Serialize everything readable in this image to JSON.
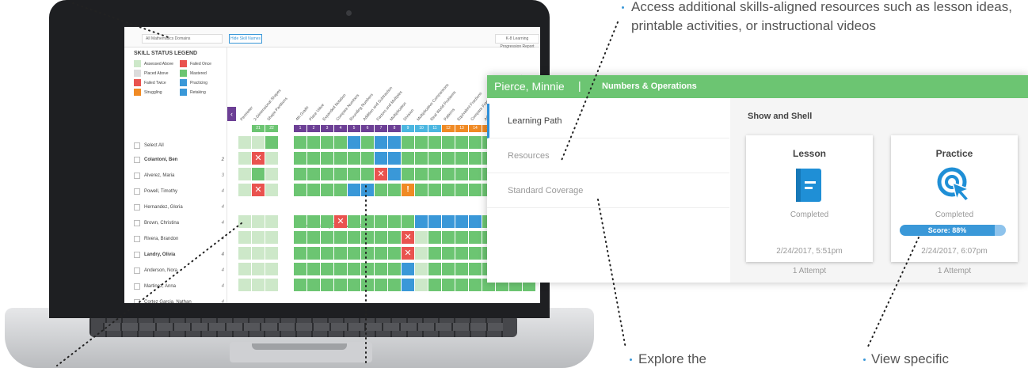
{
  "screen": {
    "domain_select": "All Mathematics Domains",
    "hide_button": "Hide Skill Names",
    "report_button": "K-8 Learning Progression Report",
    "legend_title": "SKILL STATUS LEGEND",
    "legend": [
      {
        "label": "Assessed Above",
        "color": "#cde8c9"
      },
      {
        "label": "Failed Once",
        "color": "#e9534f"
      },
      {
        "label": "Placed Above",
        "color": "#dcdcdc"
      },
      {
        "label": "Mastered",
        "color": "#6cc572"
      },
      {
        "label": "Failed Twice",
        "color": "#e9534f"
      },
      {
        "label": "Practicing",
        "color": "#3a98d8"
      },
      {
        "label": "Struggling",
        "color": "#f08a24"
      },
      {
        "label": "Retaking",
        "color": "#3a98d8"
      }
    ],
    "select_all": "Select All",
    "students": [
      {
        "name": "Colantoni, Ben",
        "count": "2"
      },
      {
        "name": "Alverez, Maria",
        "count": "3"
      },
      {
        "name": "Powell, Timothy",
        "count": "4"
      },
      {
        "name": "Hernandez, Gloria",
        "count": "4"
      },
      {
        "name": "Brown, Christina",
        "count": "4"
      },
      {
        "name": "Rivera, Brandon",
        "count": "4"
      },
      {
        "name": "Landry, Olivia",
        "count": "4"
      },
      {
        "name": "Anderson, Nora",
        "count": "4"
      },
      {
        "name": "Martinez, Anna",
        "count": "4"
      },
      {
        "name": "Cortez Garcia, Nathan",
        "count": "4"
      }
    ],
    "skills": [
      "Perimeter",
      "2-Dimensional Shapes",
      "Shape Partitions",
      "4th Grade",
      "Place Value",
      "Expanded Notation",
      "Compare Numbers",
      "Rounding Numbers",
      "Addition and Subtraction",
      "Factors and Multiples",
      "Multiplication",
      "Division",
      "Multiplicative Comparisons",
      "Real World Problems",
      "Patterns",
      "Equivalent Fractions",
      "Compare Fractions",
      "Adding and Subtracting Fractions"
    ],
    "skill_numbers": [
      "21",
      "22",
      "1",
      "2",
      "3",
      "4",
      "5",
      "6",
      "7",
      "8",
      "9",
      "10",
      "11",
      "12",
      "13",
      "14",
      "15"
    ],
    "no_path": "No Learning Path Available"
  },
  "panel": {
    "student": "Pierce, Minnie",
    "separator": "|",
    "unit": "Numbers & Operations",
    "nav": [
      "Learning Path",
      "Resources",
      "Standard Coverage"
    ],
    "section": "Show and Shell",
    "lesson": {
      "title": "Lesson",
      "status": "Completed",
      "date": "2/24/2017, 5:51pm",
      "attempts": "1 Attempt"
    },
    "practice": {
      "title": "Practice",
      "status": "Completed",
      "score": "Score: 88%",
      "score_fraction": 0.88,
      "date": "2/24/2017, 6:07pm",
      "attempts": "1 Attempt"
    }
  },
  "annotations": {
    "resources_note": "Access additional skills-aligned resources such as lesson ideas, printable activities, or instructional videos",
    "explore": "Explore the",
    "view": "View specific"
  }
}
